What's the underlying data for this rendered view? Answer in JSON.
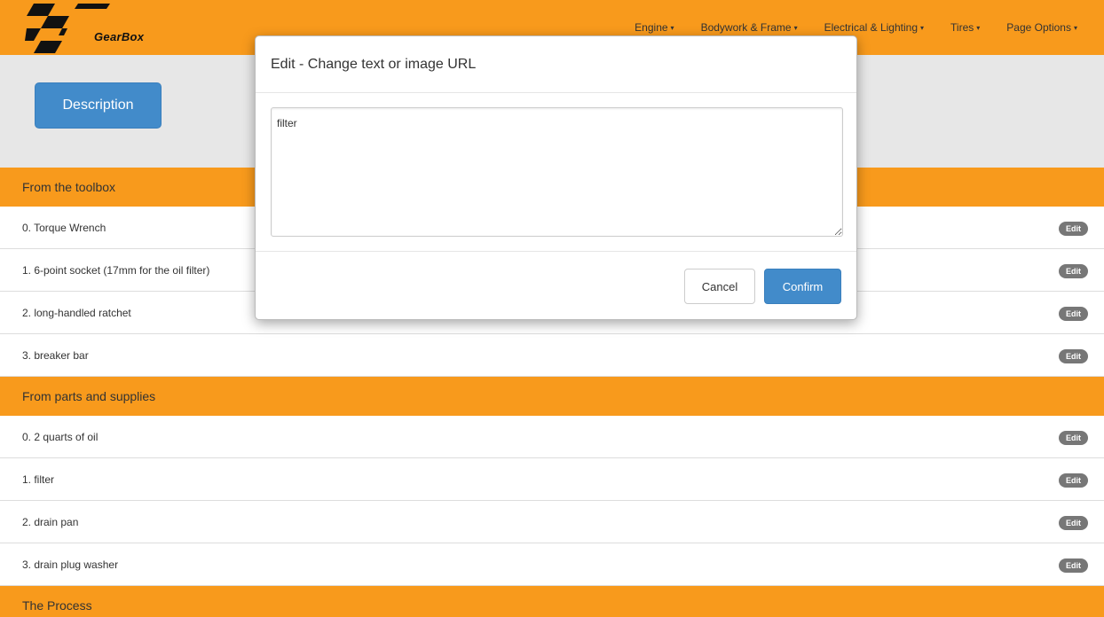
{
  "brand": {
    "name": "GearBox"
  },
  "nav": {
    "items": [
      {
        "label": "Engine"
      },
      {
        "label": "Bodywork & Frame"
      },
      {
        "label": "Electrical & Lighting"
      },
      {
        "label": "Tires"
      },
      {
        "label": "Page Options"
      }
    ]
  },
  "jumbotron": {
    "button_label": "Description"
  },
  "sections": [
    {
      "title": "From the toolbox",
      "items": [
        {
          "label": "0. Torque Wrench",
          "edit": "Edit"
        },
        {
          "label": "1. 6-point socket (17mm for the oil filter)",
          "edit": "Edit"
        },
        {
          "label": "2. long-handled ratchet",
          "edit": "Edit"
        },
        {
          "label": "3. breaker bar",
          "edit": "Edit"
        }
      ]
    },
    {
      "title": "From parts and supplies",
      "items": [
        {
          "label": "0. 2 quarts of oil",
          "edit": "Edit"
        },
        {
          "label": "1. filter",
          "edit": "Edit"
        },
        {
          "label": "2. drain pan",
          "edit": "Edit"
        },
        {
          "label": "3. drain plug washer",
          "edit": "Edit"
        }
      ]
    },
    {
      "title": "The Process",
      "items": []
    }
  ],
  "modal": {
    "title": "Edit - Change text or image URL",
    "textarea_value": "filter",
    "cancel_label": "Cancel",
    "confirm_label": "Confirm"
  },
  "colors": {
    "brand_orange": "#f89a1c",
    "primary_blue": "#428bca",
    "badge_gray": "#777777"
  }
}
